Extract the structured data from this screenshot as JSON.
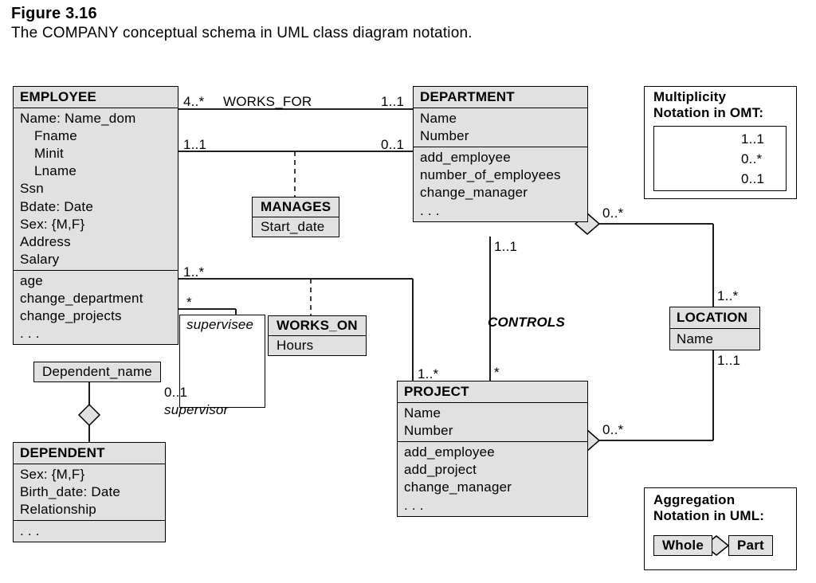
{
  "figure": {
    "number": "Figure 3.16",
    "caption": "The COMPANY conceptual schema in UML class diagram notation."
  },
  "employee": {
    "title": "EMPLOYEE",
    "a1": "Name: Name_dom",
    "a2": "Fname",
    "a3": "Minit",
    "a4": "Lname",
    "a5": "Ssn",
    "a6": "Bdate: Date",
    "a7": "Sex: {M,F}",
    "a8": "Address",
    "a9": "Salary",
    "o1": "age",
    "o2": "change_department",
    "o3": "change_projects",
    "o4": ". . ."
  },
  "dependent": {
    "title": "DEPENDENT",
    "a1": "Sex: {M,F}",
    "a2": "Birth_date: Date",
    "a3": "Relationship",
    "o1": ". . ."
  },
  "dependent_name": "Dependent_name",
  "department": {
    "title": "DEPARTMENT",
    "a1": "Name",
    "a2": "Number",
    "o1": "add_employee",
    "o2": "number_of_employees",
    "o3": "change_manager",
    "o4": ". . ."
  },
  "project": {
    "title": "PROJECT",
    "a1": "Name",
    "a2": "Number",
    "o1": "add_employee",
    "o2": "add_project",
    "o3": "change_manager",
    "o4": ". . ."
  },
  "location": {
    "title": "LOCATION",
    "a1": "Name"
  },
  "manages": {
    "title": "MANAGES",
    "a1": "Start_date"
  },
  "works_on": {
    "title": "WORKS_ON",
    "a1": "Hours"
  },
  "works_for": "WORKS_FOR",
  "controls": "CONTROLS",
  "mult": {
    "four_star": "4..*",
    "one_one": "1..1",
    "zero_one": "0..1",
    "one_star": "1..*",
    "star": "*",
    "zero_star": "0..*"
  },
  "roles": {
    "supervisee": "supervisee",
    "supervisor": "supervisor"
  },
  "omt": {
    "title1": "Multiplicity",
    "title2": "Notation in OMT:",
    "l1": "1..1",
    "l2": "0..*",
    "l3": "0..1"
  },
  "agg": {
    "title1": "Aggregation",
    "title2": "Notation in UML:",
    "whole": "Whole",
    "part": "Part"
  }
}
